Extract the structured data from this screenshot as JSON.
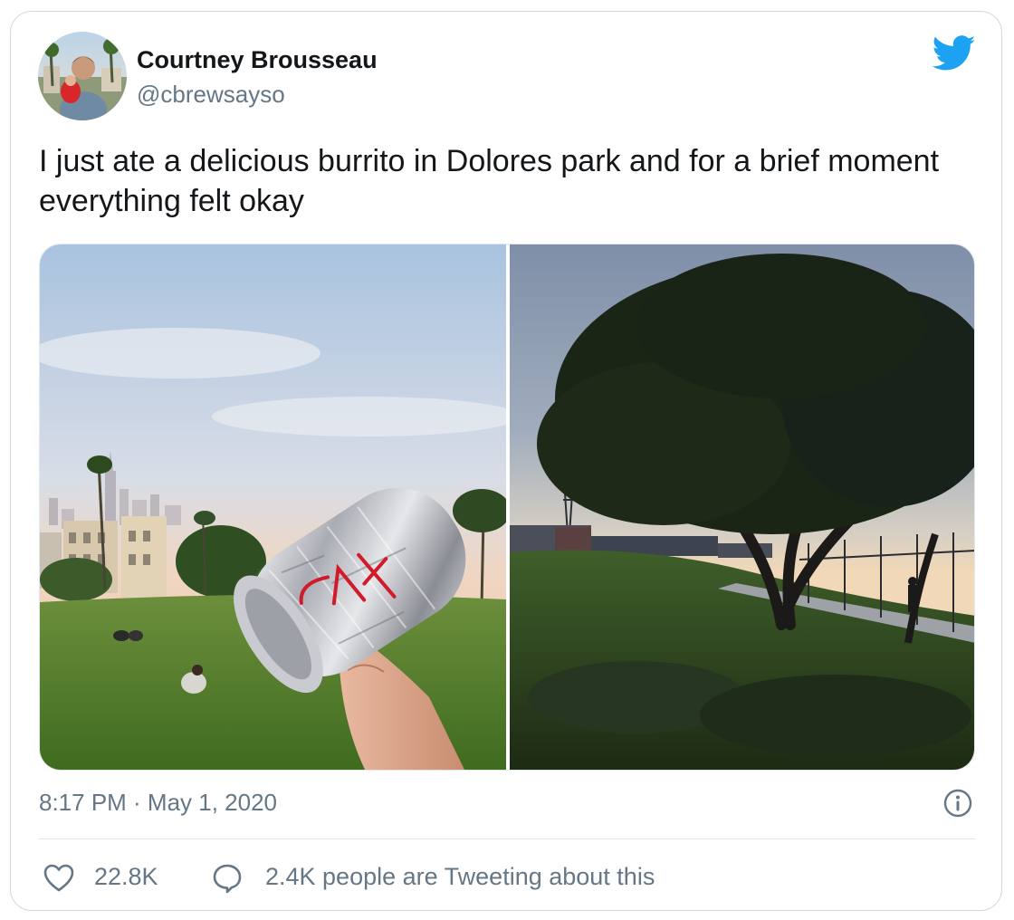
{
  "user": {
    "display_name": "Courtney Brousseau",
    "handle": "@cbrewsayso"
  },
  "tweet": {
    "text": "I just ate a delicious burrito in Dolores park and for a brief moment everything felt okay",
    "timestamp": "8:17 PM · May 1, 2020"
  },
  "media": {
    "image_count": 2
  },
  "engagement": {
    "likes": "22.8K",
    "conversation": "2.4K people are Tweeting about this"
  },
  "icons": {
    "brand": "twitter-bird-icon",
    "info": "info-icon",
    "like": "heart-icon",
    "reply": "speech-bubble-icon"
  },
  "colors": {
    "brand_blue": "#1da1f2",
    "text_primary": "#14171a",
    "text_secondary": "#657786",
    "border": "#cfd9de"
  }
}
